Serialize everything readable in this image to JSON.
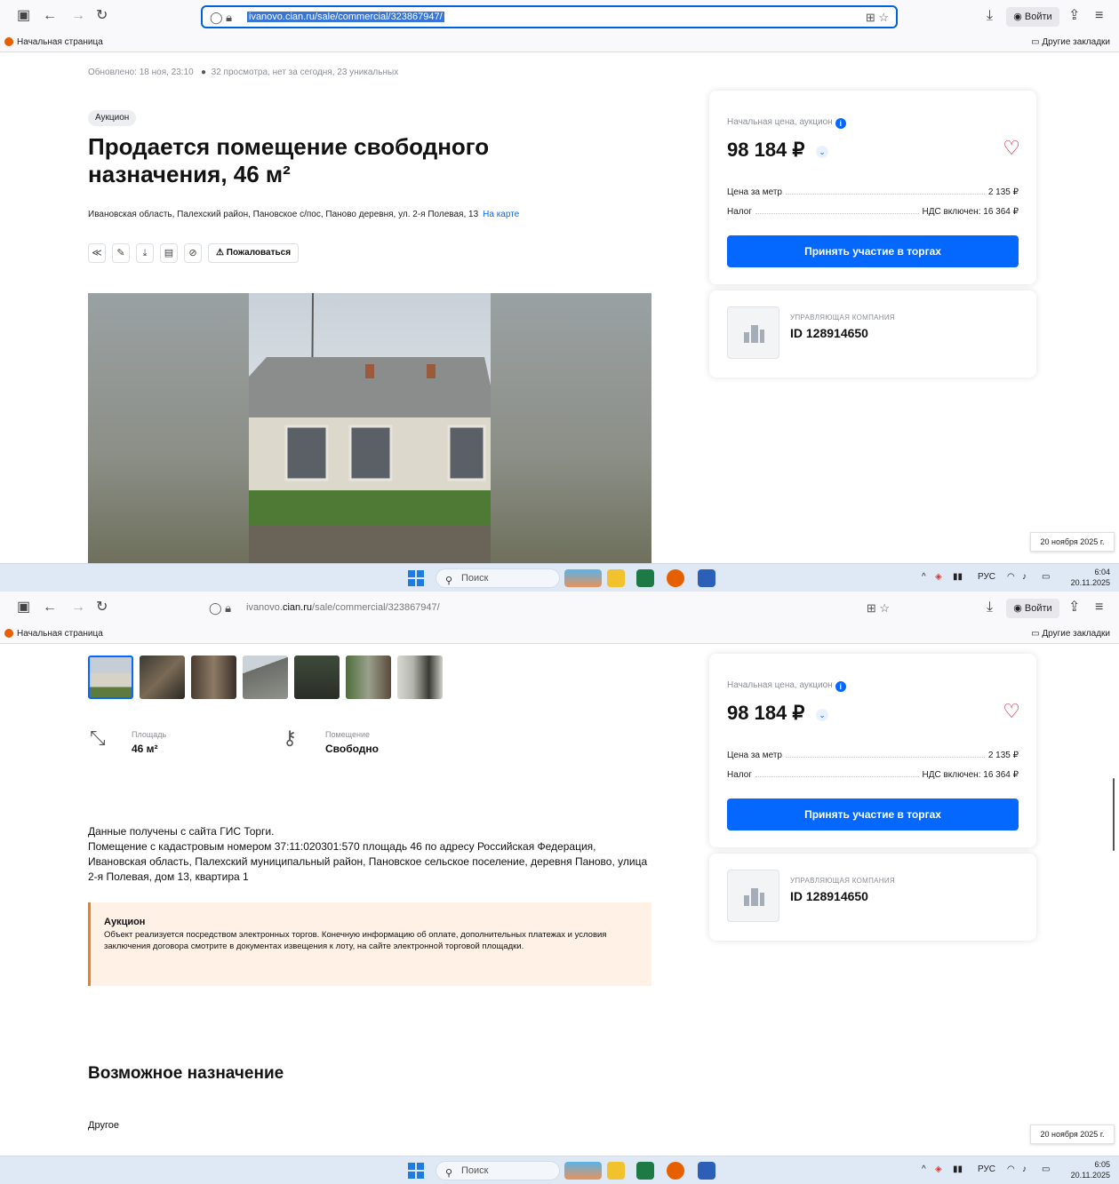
{
  "browser": {
    "url_prefix": "ivanovo.",
    "url_domain": "cian.ru",
    "url_path": "/sale/commercial/323867947/",
    "url_full": "ivanovo.cian.ru/sale/commercial/323867947/",
    "login_label": "Войти",
    "bookmark_home": "Начальная страница",
    "bookmark_other": "Другие закладки"
  },
  "listing": {
    "updated": "Обновлено: 18 ноя, 23:10",
    "views": "32 просмотра, нет за сегодня, 23 уникальных",
    "badge": "Аукцион",
    "title": "Продается помещение свободного назначения, 46 м²",
    "address": "Ивановская область, Палехский район, Пановское с/пос, Паново деревня, ул. 2-я Полевая, 13",
    "map_link": "На карте",
    "complain_label": "Пожаловаться"
  },
  "price_card": {
    "label": "Начальная цена, аукцион",
    "price": "98 184 ₽",
    "rows": [
      {
        "label": "Цена за метр",
        "value": "2 135 ₽"
      },
      {
        "label": "Налог",
        "value": "НДС включен: 16 364 ₽"
      }
    ],
    "button": "Принять участие в торгах"
  },
  "company": {
    "kind": "УПРАВЛЯЮЩАЯ КОМПАНИЯ",
    "id": "ID 128914650"
  },
  "features": [
    {
      "label": "Площадь",
      "value": "46 м²",
      "icon": "area-icon"
    },
    {
      "label": "Помещение",
      "value": "Свободно",
      "icon": "key-icon"
    }
  ],
  "description": {
    "line1": "Данные получены с сайта ГИС Торги.",
    "line2": "Помещение с кадастровым номером 37:11:020301:570 площадь 46 по адресу Российская Федерация, Ивановская область, Палехский муниципальный район, Пановское сельское поселение, деревня Паново, улица 2-я Полевая, дом 13, квартира 1"
  },
  "auction_notice": {
    "title": "Аукцион",
    "text": "Объект реализуется посредством электронных торгов. Конечную информацию об оплате, дополнительных платежах и условия заключения договора смотрите в документах извещения к лоту, на сайте электронной торговой площадки."
  },
  "purpose": {
    "title": "Возможное назначение",
    "value": "Другое"
  },
  "date_badge": "20 ноября 2025 г.",
  "taskbar": {
    "search": "Поиск",
    "lang": "РУС",
    "shot1_time": "6:04",
    "shot2_time": "6:05",
    "date": "20.11.2025"
  },
  "colors": {
    "accent": "#0468ff",
    "heart": "#d21f3c",
    "notice_border": "#f37c20",
    "notice_bg": "#fff1e6"
  }
}
